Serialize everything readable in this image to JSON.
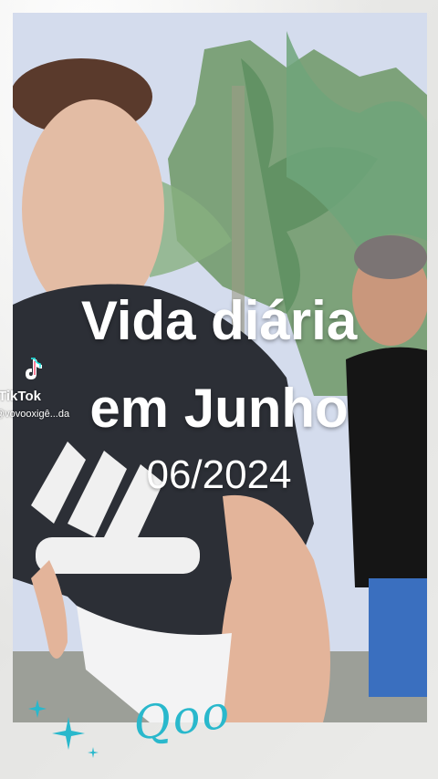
{
  "overlay": {
    "title_line1": "Vida diária",
    "title_line2": "em Junho",
    "date": "06/2024"
  },
  "watermark": {
    "brand": "TikTok",
    "username": "@vovooxigê...da"
  },
  "signature": {
    "text": "Qoo"
  },
  "colors": {
    "frame": "#eeeeec",
    "title": "#ffffff",
    "accent": "#29b8cc"
  },
  "icons": [
    "tiktok-logo-icon",
    "sparkle-icon"
  ]
}
